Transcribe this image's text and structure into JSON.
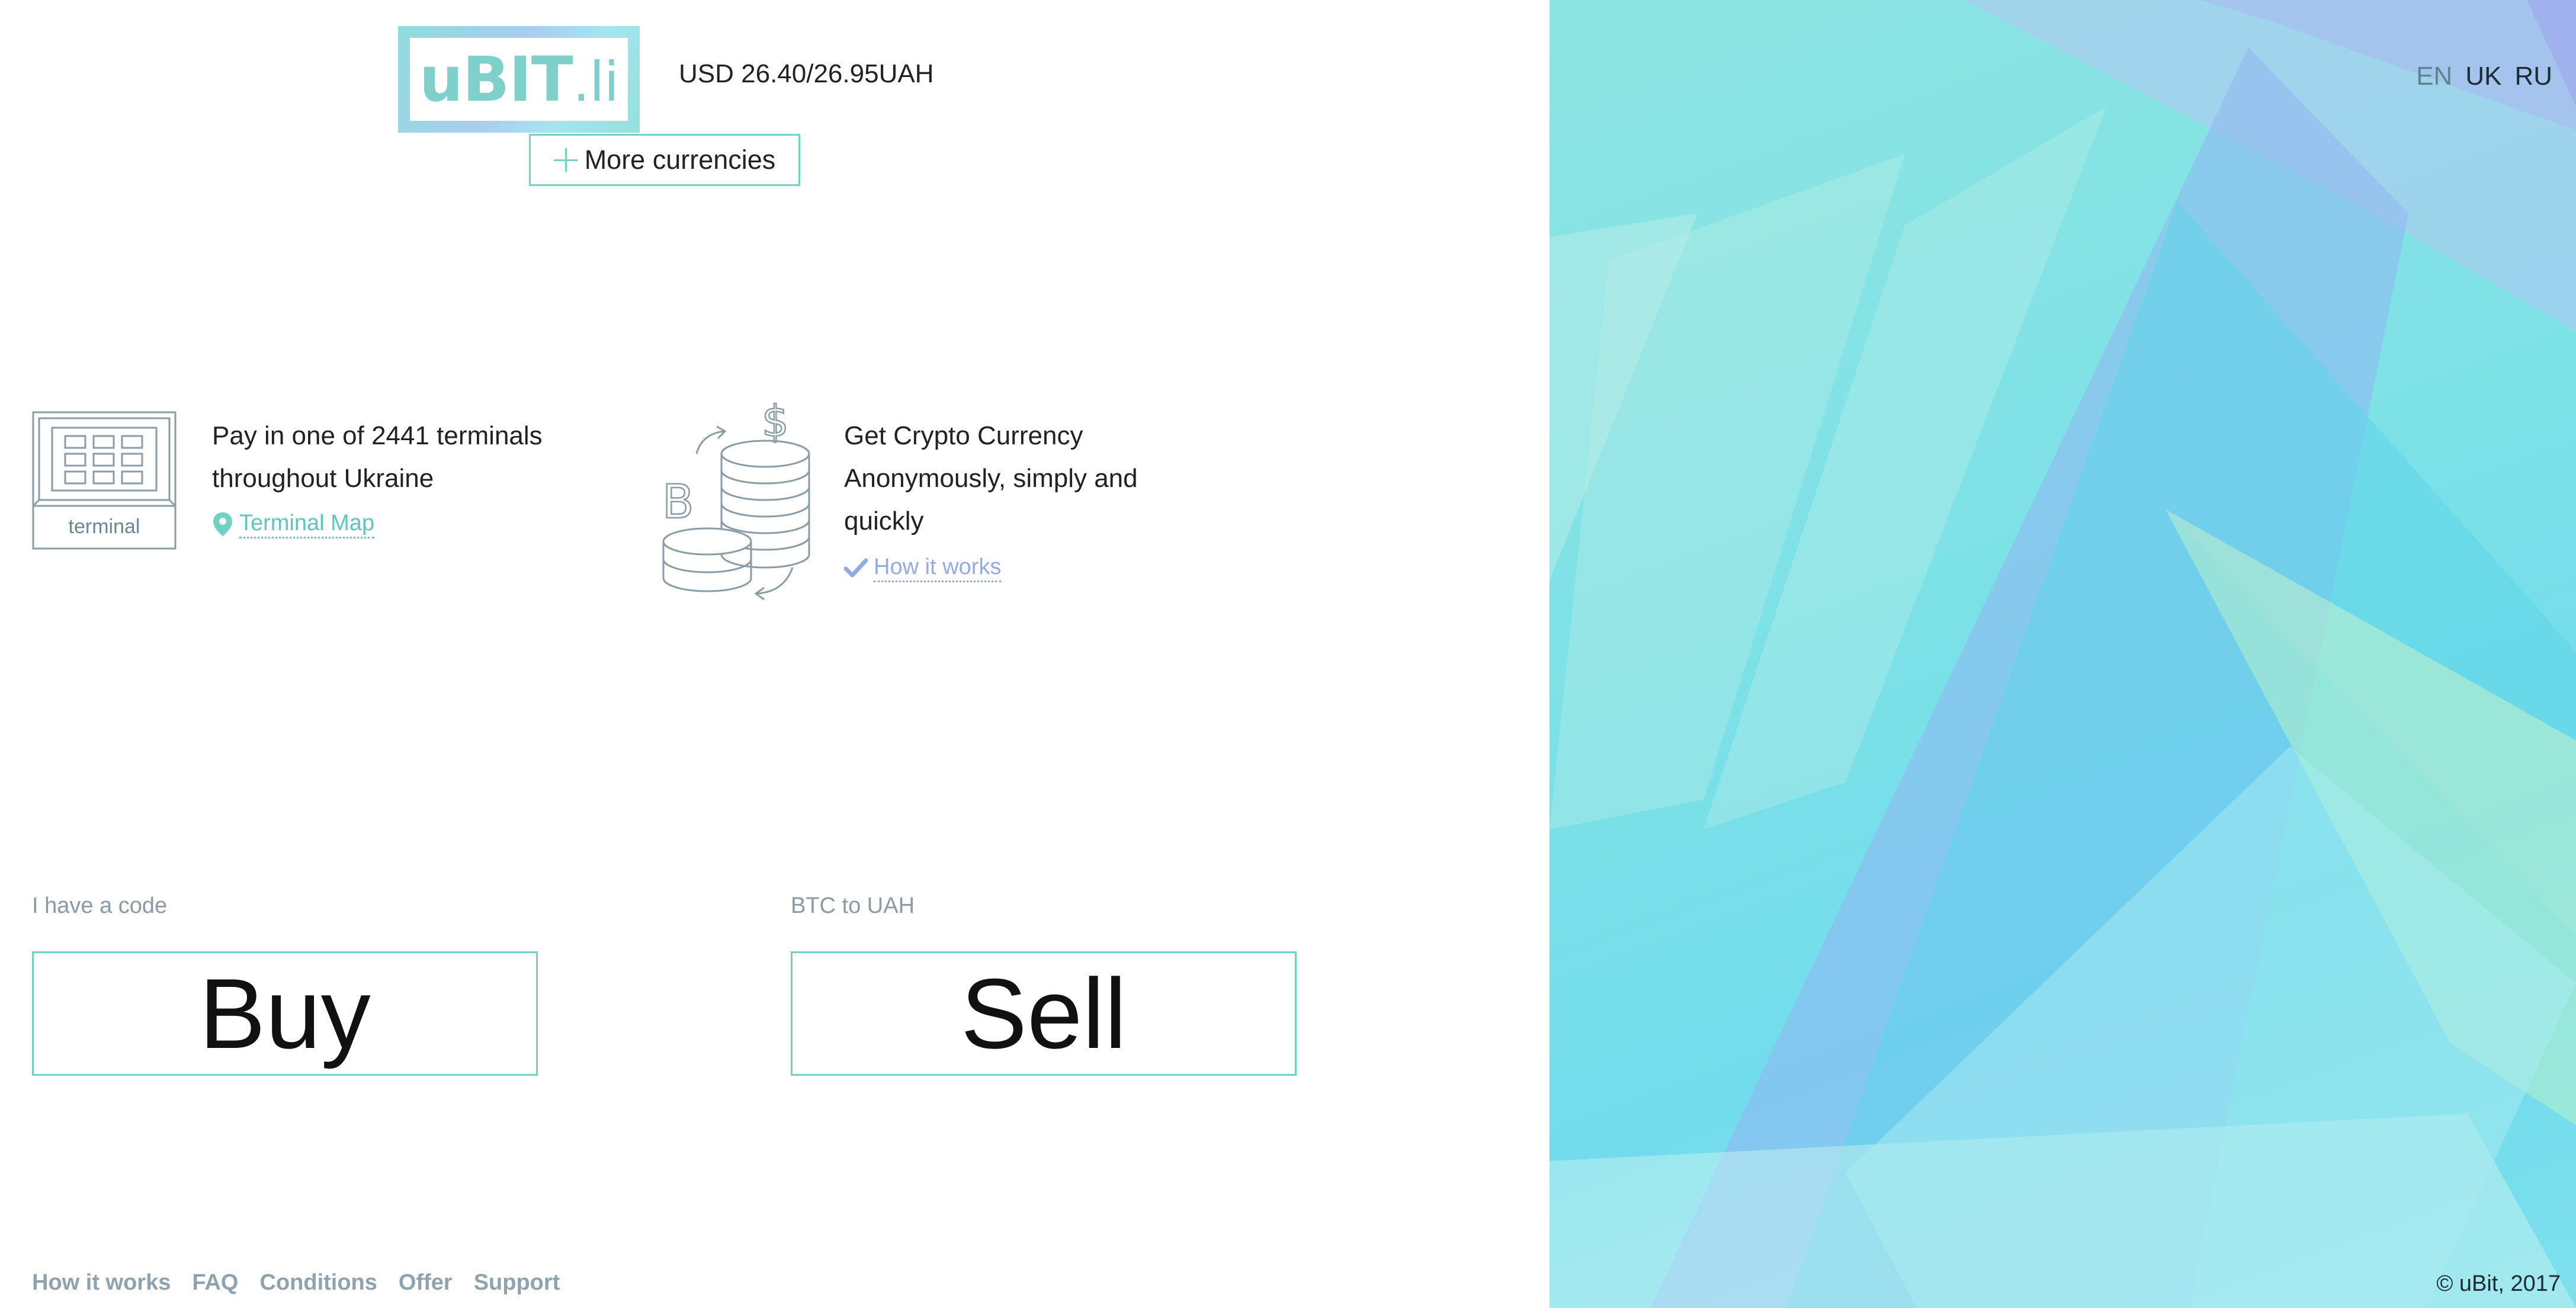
{
  "header": {
    "logo_text": "uBIT",
    "logo_suffix": ".li",
    "rate": "USD 26.40/26.95UAH",
    "more_currencies_label": "More currencies"
  },
  "features": {
    "terminal": {
      "icon_caption": "terminal",
      "line1": "Pay in one of 2441 terminals",
      "line2": "throughout Ukraine",
      "link": "Terminal Map"
    },
    "crypto": {
      "line1": "Get Crypto Currency",
      "line2": "Anonymously, simply and",
      "line3": "quickly",
      "link": "How it works"
    }
  },
  "actions": {
    "buy_label": "I have a code",
    "buy_button": "Buy",
    "sell_label": "BTC to UAH",
    "sell_button": "Sell"
  },
  "footer_nav": {
    "how_it_works": "How it works",
    "faq": "FAQ",
    "conditions": "Conditions",
    "offer": "Offer",
    "support": "Support"
  },
  "languages": {
    "en": "EN",
    "uk": "UK",
    "ru": "RU",
    "active": "EN"
  },
  "copyright": "© uBit, 2017",
  "colors": {
    "accent": "#72d2c6",
    "link_teal": "#5bc8bd",
    "link_blue": "#93abe5",
    "muted": "#8fa3ae"
  },
  "icons": {
    "terminal": "terminal-keypad-icon",
    "coins": "coins-exchange-icon",
    "map_pin": "map-pin-icon",
    "check": "checkmark-icon",
    "plus": "plus-icon"
  }
}
